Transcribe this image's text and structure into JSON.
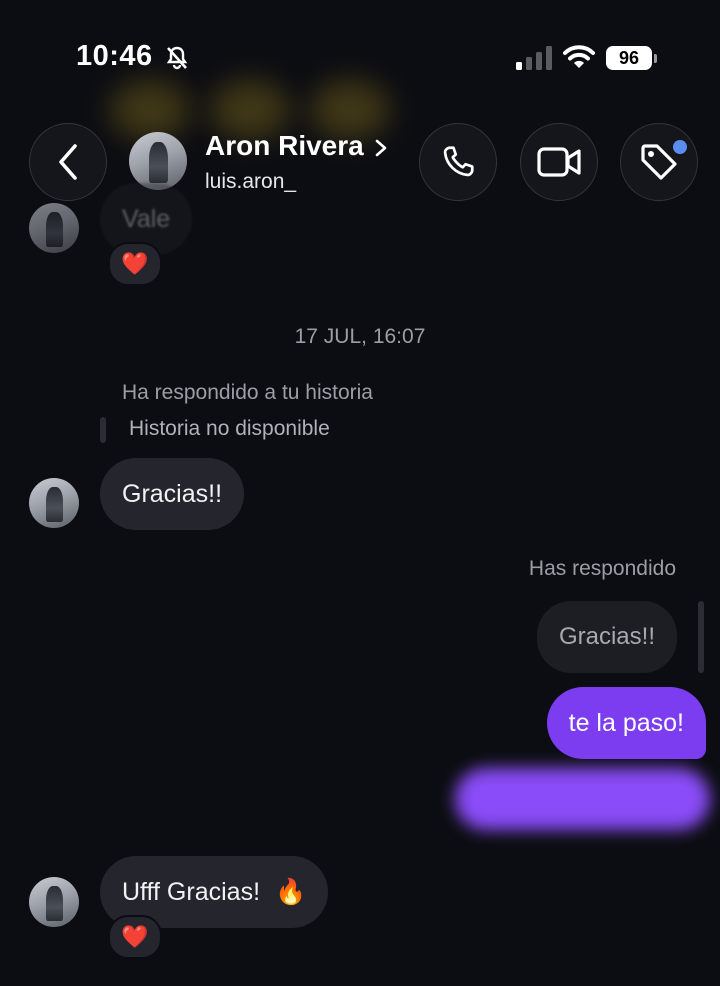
{
  "status_bar": {
    "time": "10:46",
    "battery": "96",
    "silent_icon": "bell-slash-icon",
    "signal_icon": "cellular-signal-icon",
    "wifi_icon": "wifi-icon"
  },
  "header": {
    "contact_name": "Aron Rivera",
    "contact_handle": "luis.aron_",
    "back_icon": "chevron-left-icon",
    "call_icon": "phone-icon",
    "video_icon": "video-camera-icon",
    "tag_icon": "tag-icon"
  },
  "messages": {
    "top_partial": "Vale",
    "timestamp": "17 JUL, 16:07",
    "story_reply_label": "Ha respondido a tu historia",
    "story_unavailable": "Historia no disponible",
    "incoming_1": "Gracias!!",
    "you_replied_label": "Has respondido",
    "quoted": "Gracias!!",
    "outgoing_1": "te la paso!",
    "incoming_2": "Ufff Gracias!",
    "fire_emoji": "🔥",
    "heart_reaction": "❤️"
  },
  "colors": {
    "background": "#0c0d12",
    "incoming_bubble": "#25262d",
    "outgoing_bubble": "#7c3df0",
    "accent_dot": "#5b8def"
  }
}
